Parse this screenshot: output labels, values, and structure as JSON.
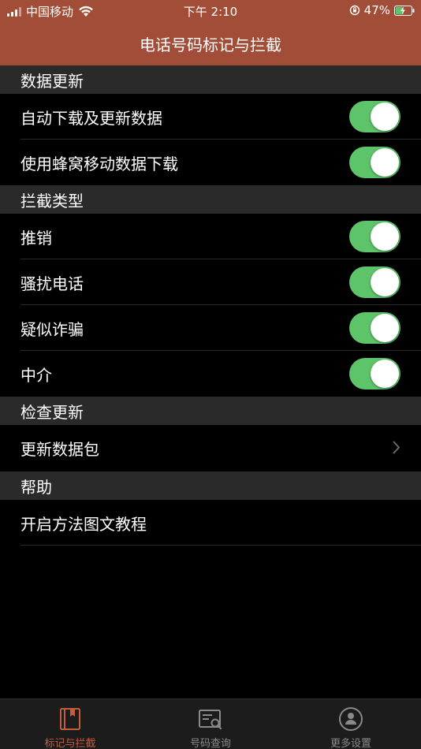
{
  "status": {
    "carrier": "中国移动",
    "time": "下午 2:10",
    "battery": "47%"
  },
  "nav": {
    "title": "电话号码标记与拦截"
  },
  "sections": {
    "data_update": {
      "header": "数据更新",
      "items": [
        {
          "label": "自动下载及更新数据",
          "on": true
        },
        {
          "label": "使用蜂窝移动数据下载",
          "on": true
        }
      ]
    },
    "block_types": {
      "header": "拦截类型",
      "items": [
        {
          "label": "推销",
          "on": true
        },
        {
          "label": "骚扰电话",
          "on": true
        },
        {
          "label": "疑似诈骗",
          "on": true
        },
        {
          "label": "中介",
          "on": true
        }
      ]
    },
    "check_update": {
      "header": "检查更新",
      "items": [
        {
          "label": "更新数据包"
        }
      ]
    },
    "help": {
      "header": "帮助",
      "items": [
        {
          "label": "开启方法图文教程"
        }
      ]
    }
  },
  "tabs": [
    {
      "label": "标记与拦截",
      "icon": "bookmark-icon",
      "active": true
    },
    {
      "label": "号码查询",
      "icon": "search-card-icon",
      "active": false
    },
    {
      "label": "更多设置",
      "icon": "person-icon",
      "active": false
    }
  ],
  "colors": {
    "accent": "#a24d37",
    "toggle_on": "#5ec46a",
    "active_tab": "#c75b3e"
  }
}
